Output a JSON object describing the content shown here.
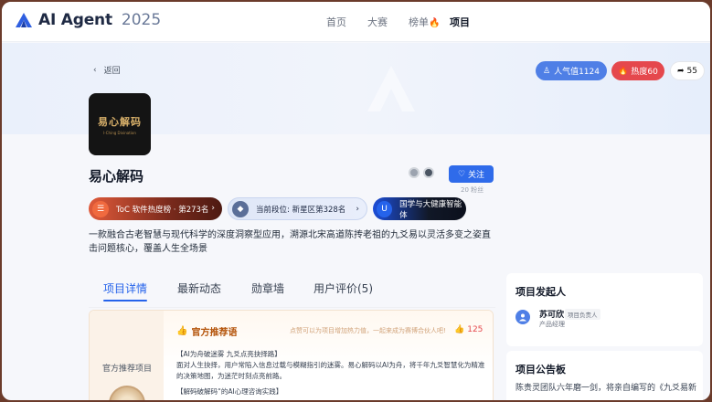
{
  "brand": {
    "name": "AI Agent",
    "year": "2025"
  },
  "nav": [
    {
      "label": "首页"
    },
    {
      "label": "大赛"
    },
    {
      "label": "榜单"
    },
    {
      "label": "项目"
    }
  ],
  "header": {
    "back_label": "返回",
    "popularity": "人气值1124",
    "heat": "热度60",
    "share_count": "55"
  },
  "project": {
    "cover_title": "易心解码",
    "cover_subtitle": "I-Ching Divination",
    "name": "易心解码",
    "follow_label": "关注",
    "fans": "20 粉丝",
    "description": "一款融合古老智慧与现代科学的深度洞察型应用，溯源北宋高道陈抟老祖的九爻易以灵活多变之姿直击问题核心，覆盖人生全场景"
  },
  "tags": [
    {
      "label": "ToC 软件热度榜 · 第273名"
    },
    {
      "label": "当前段位: 新星区第328名"
    },
    {
      "label": "国学与大健康智能体"
    }
  ],
  "tabs": [
    {
      "label": "项目详情"
    },
    {
      "label": "最新动态"
    },
    {
      "label": "勋章墙"
    },
    {
      "label": "用户评价(5)"
    }
  ],
  "recommend": {
    "side_label": "官方推荐项目",
    "title": "官方推荐语",
    "hint": "点赞可以为项目增加热力值，一起来成为赛博合伙人吧!",
    "likes": "125",
    "lines": [
      "【AI为舟破迷雾 九爻点亮抉择路】",
      "面对人生抉择，用户常陷入信息过载与模糊指引的迷雾。易心解码以AI为舟，将千年九爻智慧化为精准的决策地图，为迷茫时刻点亮前路。",
      "【解码破解码“的AI心理咨询实践】"
    ]
  },
  "sidebar": {
    "initiator_title": "项目发起人",
    "initiator_name": "苏可欣",
    "initiator_badge": "项目负责人",
    "initiator_role": "产品经理",
    "notice_title": "项目公告板",
    "notice_text": "陈贵灵团队六年磨一剑，将亲自编写的《九爻易新"
  },
  "colors": {
    "primary": "#2563eb",
    "heat": "#e5484d",
    "popularity": "#4f7fe6",
    "frame": "#6b3b2b"
  }
}
